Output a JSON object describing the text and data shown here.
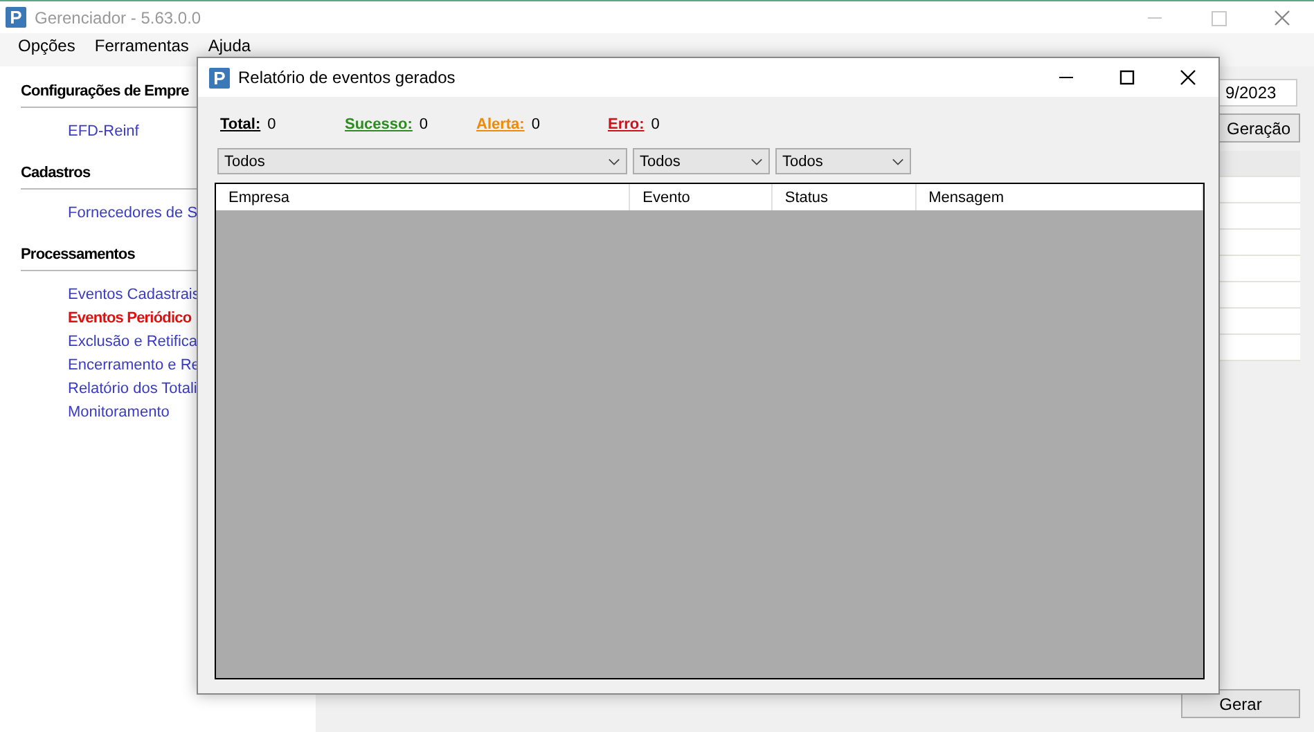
{
  "window": {
    "icon_letter": "P",
    "title": "Gerenciador - 5.63.0.0"
  },
  "menu": [
    "Opções",
    "Ferramentas",
    "Ajuda"
  ],
  "sidebar": [
    {
      "title": "Configurações de Empre",
      "items": [
        {
          "label": "EFD-Reinf",
          "selected": false
        }
      ]
    },
    {
      "title": "Cadastros",
      "items": [
        {
          "label": "Fornecedores de S",
          "selected": false
        }
      ]
    },
    {
      "title": "Processamentos",
      "items": [
        {
          "label": "Eventos Cadastrais",
          "selected": false
        },
        {
          "label": "Eventos Periódico",
          "selected": true
        },
        {
          "label": "Exclusão e Retifica",
          "selected": false
        },
        {
          "label": "Encerramento e Re",
          "selected": false
        },
        {
          "label": "Relatório dos Totali",
          "selected": false
        },
        {
          "label": "Monitoramento",
          "selected": false
        }
      ]
    }
  ],
  "main": {
    "date_value": "9/2023",
    "generation_button": "Geração",
    "generate_button": "Gerar"
  },
  "dialog": {
    "icon_letter": "P",
    "title": "Relatório de eventos gerados",
    "counters": [
      {
        "label": "Total:",
        "value": "0",
        "color": "#000000"
      },
      {
        "label": "Sucesso:",
        "value": "0",
        "color": "#2e8b22"
      },
      {
        "label": "Alerta:",
        "value": "0",
        "color": "#f08a00"
      },
      {
        "label": "Erro:",
        "value": "0",
        "color": "#d0101a"
      }
    ],
    "filters": [
      "Todos",
      "Todos",
      "Todos"
    ],
    "table": {
      "columns": [
        "Empresa",
        "Evento",
        "Status",
        "Mensagem"
      ]
    }
  }
}
